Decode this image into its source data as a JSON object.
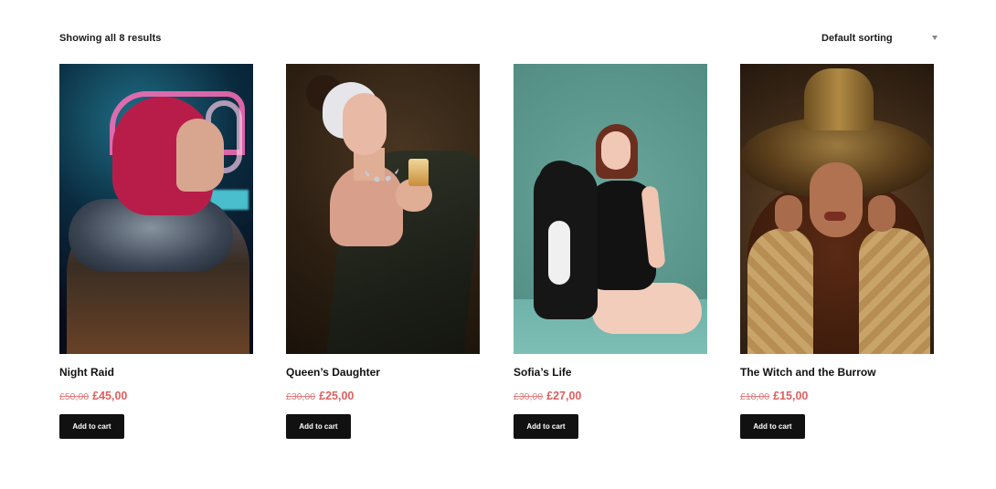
{
  "toolbar": {
    "result_count": "Showing all 8 results",
    "sort_selected": "Default sorting"
  },
  "products": [
    {
      "title": "Night Raid",
      "old_price": "£50,00",
      "new_price": "£45,00",
      "cart_label": "Add to cart",
      "image": "photo-woman-neon-sign"
    },
    {
      "title": "Queen’s Daughter",
      "old_price": "£30,00",
      "new_price": "£25,00",
      "cart_label": "Add to cart",
      "image": "photo-woman-holding-cup"
    },
    {
      "title": "Sofia’s Life",
      "old_price": "£30,00",
      "new_price": "£27,00",
      "cart_label": "Add to cart",
      "image": "photo-woman-with-dog"
    },
    {
      "title": "The Witch and the Burrow",
      "old_price": "£18,00",
      "new_price": "£15,00",
      "cart_label": "Add to cart",
      "image": "photo-woman-gold-hat"
    }
  ],
  "colors": {
    "price_old": "#e07a7a",
    "price_new": "#df5f5f",
    "button_bg": "#111111",
    "button_text": "#ffffff"
  }
}
